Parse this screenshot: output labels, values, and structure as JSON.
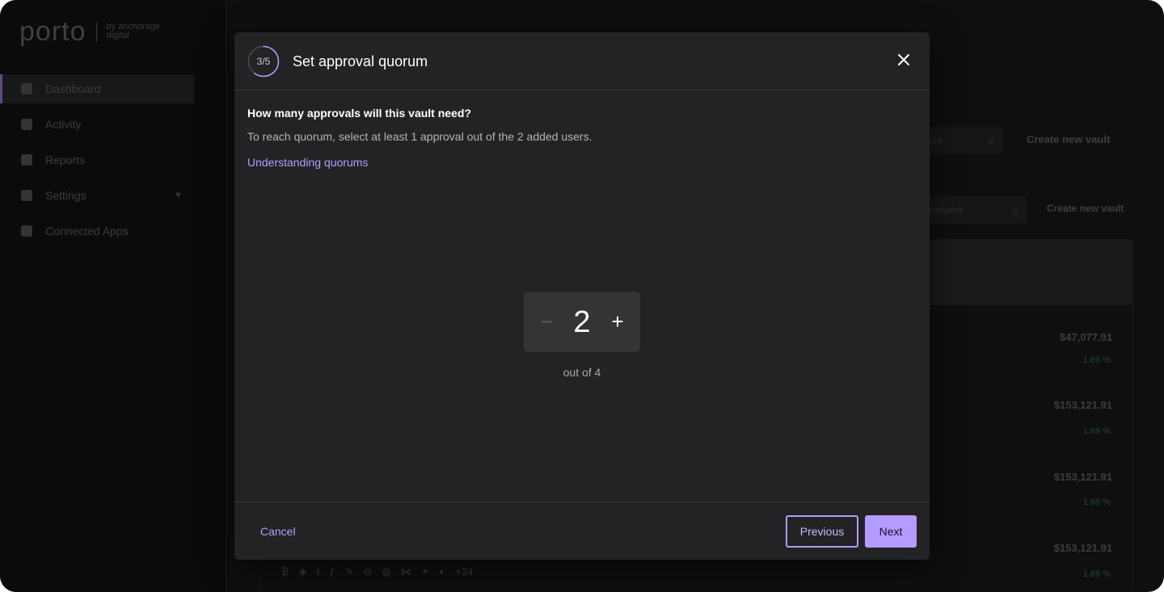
{
  "background": {
    "logo": {
      "word": "porto",
      "sub": "by anchorage digital"
    },
    "nav": [
      {
        "label": "Dashboard",
        "icon": "home-icon",
        "active": true
      },
      {
        "label": "Activity",
        "icon": "list-icon",
        "active": false
      },
      {
        "label": "Reports",
        "icon": "report-icon",
        "active": false
      },
      {
        "label": "Settings",
        "icon": "gear-icon",
        "active": false
      },
      {
        "label": "Connected Apps",
        "icon": "puzzle-icon",
        "active": false
      }
    ],
    "search_placeholder_1": "work",
    "search_placeholder_2": "network",
    "create_vault_label": "Create new vault",
    "values": [
      "$47,077.91",
      "$153,121.91",
      "$153,121.91",
      "$153,121.91"
    ],
    "pcts": [
      "1.69 %",
      "1.69 %",
      "1.69 %",
      "1.69 %"
    ],
    "coins_more": "+24"
  },
  "modal": {
    "step": "3/5",
    "step_progress": 0.6,
    "title": "Set approval quorum",
    "question": "How many approvals will this vault need?",
    "description": "To reach quorum, select at least 1 approval out of the 2 added users.",
    "link_label": "Understanding quorums",
    "stepper": {
      "minus": "−",
      "value": "2",
      "plus": "+"
    },
    "out_of": "out of 4",
    "footer": {
      "cancel": "Cancel",
      "previous": "Previous",
      "next": "Next"
    }
  },
  "colors": {
    "accent": "#b39bff",
    "modal_bg": "#232325",
    "page_bg": "#0f0f10"
  }
}
